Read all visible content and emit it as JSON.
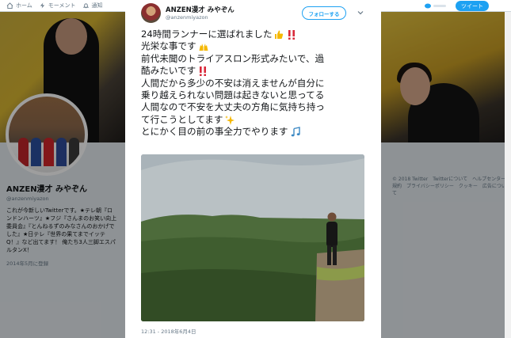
{
  "nav": {
    "home_label": "ホーム",
    "moments_label": "モーメント",
    "notifications_label": "通知",
    "tweet_button_label": "ツイート"
  },
  "profile": {
    "name": "ANZEN漫才 みやぞん",
    "handle": "@anzenmiyazon",
    "bio": "これが今新しいTwitterです。★テレ朝『ロンドンハーツ』★フジ『さんまのお笑い向上委員会』『とんねるずのみなさんのおかげでした』★日テレ『世界の果てまでイッテQ！』など出てます！ 俺たち3人三脚エスパルタンX！",
    "joined": "2014年5月に登録"
  },
  "footer_links": "© 2018 Twitter　Twitterについて　ヘルプセンター　規約　プライバシーポリシー　クッキー　広告について",
  "tweet": {
    "author_name": "ANZEN漫才 みやぞん",
    "author_handle": "@anzenmiyazon",
    "follow_label": "フォローする",
    "lines": [
      "24時間ランナーに選ばれました",
      "光栄な事です",
      "前代未聞のトライアスロン形式みたいで、過",
      "酷みたいです",
      "人間だから多少の不安は消えませんが自分に",
      "乗り越えられない問題は起きないと思ってる",
      "人間なので不安を大丈夫の方角に気持ち持っ",
      "て行こうとしてます",
      "とにかく目の前の事全力でやります"
    ],
    "timestamp": "12:31 - 2018年6月4日"
  },
  "colors": {
    "accent": "#1da1f2",
    "emoji_red": "#d9293a",
    "emoji_yellow": "#f5b800",
    "emoji_blue": "#3b88c3"
  }
}
